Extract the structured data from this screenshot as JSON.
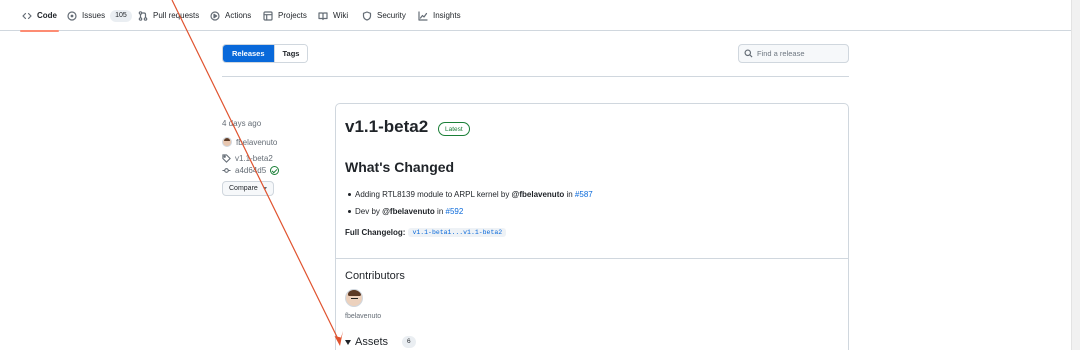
{
  "nav": {
    "code": "Code",
    "issues": "Issues",
    "issues_count": "105",
    "pulls": "Pull requests",
    "actions": "Actions",
    "projects": "Projects",
    "wiki": "Wiki",
    "security": "Security",
    "insights": "Insights"
  },
  "subnav": {
    "releases": "Releases",
    "tags": "Tags",
    "search_placeholder": "Find a release"
  },
  "meta": {
    "time": "4 days ago",
    "author": "fbelavenuto",
    "tag": "v1.1-beta2",
    "commit": "a4d64d5",
    "compare": "Compare"
  },
  "release": {
    "title": "v1.1-beta2",
    "badge": "Latest",
    "whats_changed": "What's Changed",
    "items": [
      {
        "text": "Adding RTL8139 module to ARPL kernel by ",
        "user": "@fbelavenuto",
        "in": " in ",
        "pr": "#587"
      },
      {
        "text": "Dev by ",
        "user": "@fbelavenuto",
        "in": " in ",
        "pr": "#592"
      }
    ],
    "changelog_label": "Full Changelog:",
    "changelog_link": "v1.1-beta1...v1.1-beta2",
    "contributors": "Contributors",
    "contributor_name": "fbelavenuto",
    "assets": "Assets",
    "assets_count": "6"
  },
  "colors": {
    "accent": "#0969da",
    "annotation_arrow": "#e0532f",
    "latest_green": "#1a7f37"
  }
}
